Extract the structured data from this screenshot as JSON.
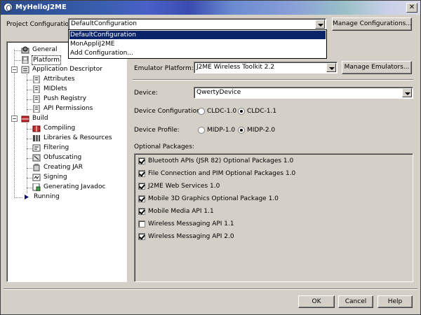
{
  "window": {
    "title": "MyHelloJ2ME",
    "close_glyph": "✕"
  },
  "project_config": {
    "label": "Project Configuration:",
    "selected": "DefaultConfiguration",
    "options": [
      "DefaultConfiguration",
      "MonAppliJ2ME",
      "Add Configuration..."
    ],
    "manage_button": "Manage Configurations..."
  },
  "tree": {
    "general": "General",
    "platform": "Platform",
    "app_descriptor": "Application Descriptor",
    "attributes": "Attributes",
    "midlets": "MIDlets",
    "push_registry": "Push Registry",
    "api_permissions": "API Permissions",
    "build": "Build",
    "compiling": "Compiling",
    "libraries": "Libraries & Resources",
    "filtering": "Filtering",
    "obfuscating": "Obfuscating",
    "creating_jar": "Creating JAR",
    "signing": "Signing",
    "javadoc": "Generating Javadoc",
    "running": "Running",
    "expander_minus": "−"
  },
  "platform": {
    "emulator_label": "Emulator Platform:",
    "emulator_value": "J2ME Wireless Toolkit 2.2",
    "manage_emulators": "Manage Emulators...",
    "device_label": "Device:",
    "device_value": "QwertyDevice",
    "device_config_label": "Device Configuration:",
    "cldc10": "CLDC-1.0",
    "cldc11": "CLDC-1.1",
    "device_profile_label": "Device Profile:",
    "midp10": "MIDP-1.0",
    "midp20": "MIDP-2.0",
    "optional_packages_label": "Optional Packages:",
    "packages": [
      {
        "label": "Bluetooth APIs (JSR 82) Optional Packages 1.0",
        "checked": true
      },
      {
        "label": "File Connection and PIM Optional Packages 1.0",
        "checked": true
      },
      {
        "label": "J2ME Web Services 1.0",
        "checked": true
      },
      {
        "label": "Mobile 3D Graphics Optional Package 1.0",
        "checked": true
      },
      {
        "label": "Mobile Media API 1.1",
        "checked": true
      },
      {
        "label": "Wireless Messaging API 1.1",
        "checked": false
      },
      {
        "label": "Wireless Messaging API 2.0",
        "checked": true
      }
    ]
  },
  "buttons": {
    "ok": "OK",
    "cancel": "Cancel",
    "help": "Help"
  },
  "colors": {
    "selection": "#0a246a",
    "face": "#d4d0c8"
  }
}
